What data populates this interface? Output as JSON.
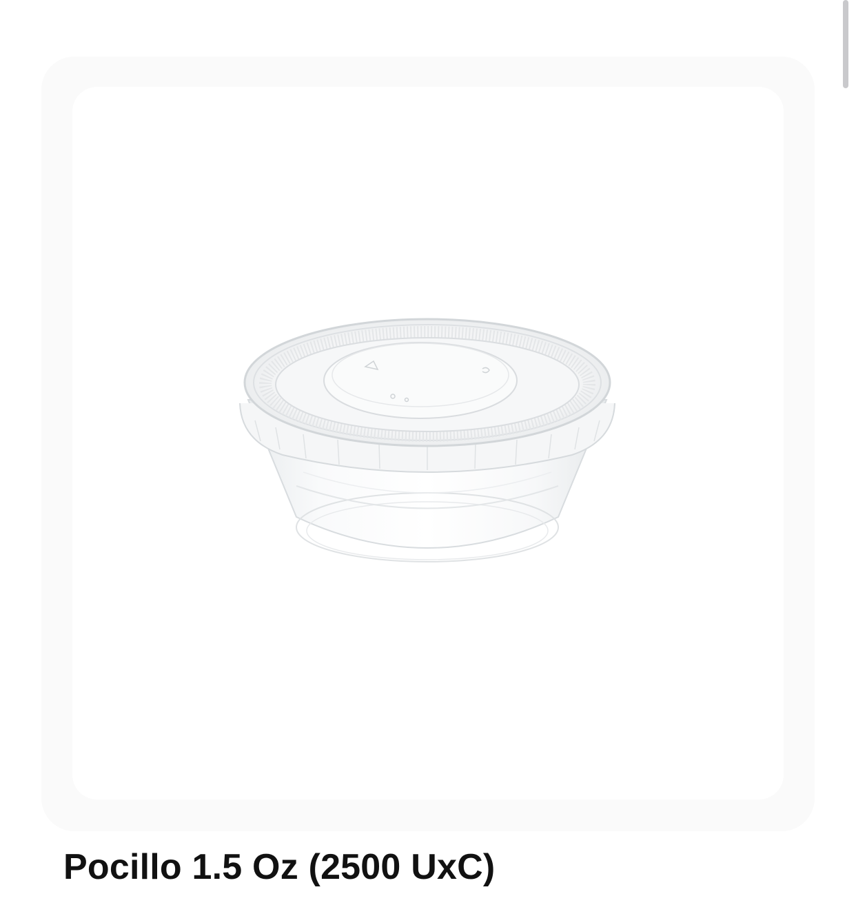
{
  "product": {
    "title": "Pocillo 1.5 Oz (2500 UxC)",
    "image_icon": "clear-plastic-portion-cup-with-lid"
  },
  "colors": {
    "card_outer": "#fafafa",
    "card_inner": "#ffffff",
    "title": "#111111",
    "scrollbar": "#c9c9cc"
  }
}
